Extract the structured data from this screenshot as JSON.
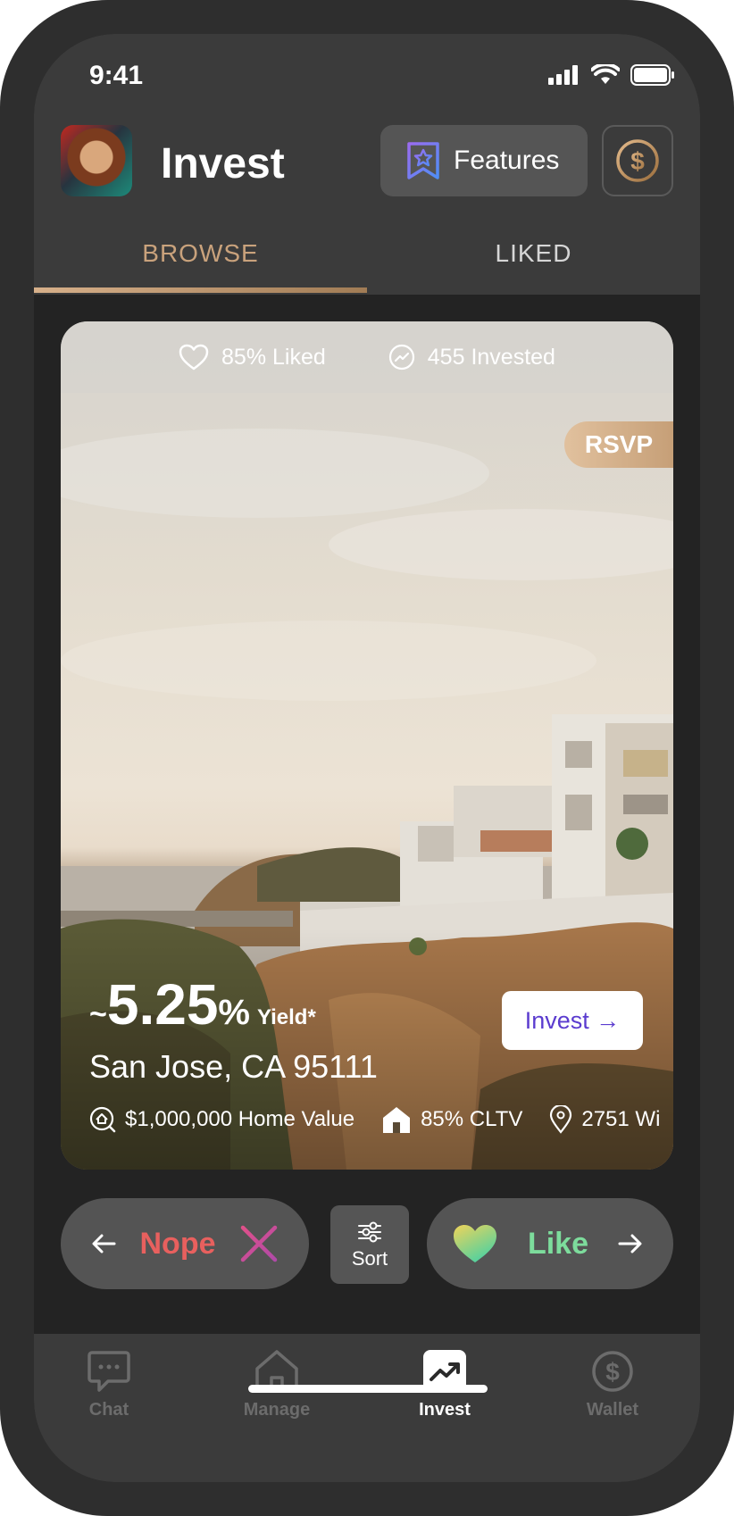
{
  "status_bar": {
    "time": "9:41"
  },
  "header": {
    "title": "Invest",
    "features_label": "Features"
  },
  "tabs": [
    {
      "label": "BROWSE",
      "active": true
    },
    {
      "label": "LIKED",
      "active": false
    }
  ],
  "listing": {
    "liked_stat": "85% Liked",
    "invested_stat": "455 Invested",
    "badge": "RSVP",
    "yield_prefix": "~",
    "yield_value": "5.25",
    "yield_unit": "%",
    "yield_label": "Yield*",
    "address": "San Jose, CA 95111",
    "invest_label": "Invest →",
    "home_value": "$1,000,000 Home Value",
    "cltv": "85% CLTV",
    "street": "2751 Wi"
  },
  "actions": {
    "nope_label": "Nope",
    "sort_label": "Sort",
    "like_label": "Like"
  },
  "bottom_nav": [
    {
      "label": "Chat",
      "icon": "chat-icon",
      "active": false
    },
    {
      "label": "Manage",
      "icon": "home-icon",
      "active": false
    },
    {
      "label": "Invest",
      "icon": "trending-up-icon",
      "active": true
    },
    {
      "label": "Wallet",
      "icon": "dollar-circle-icon",
      "active": false
    }
  ],
  "colors": {
    "accent_gold": "#c9a27c",
    "nope_red": "#e8605e",
    "like_green": "#7ddc9c",
    "invest_purple": "#5b3ccf"
  }
}
